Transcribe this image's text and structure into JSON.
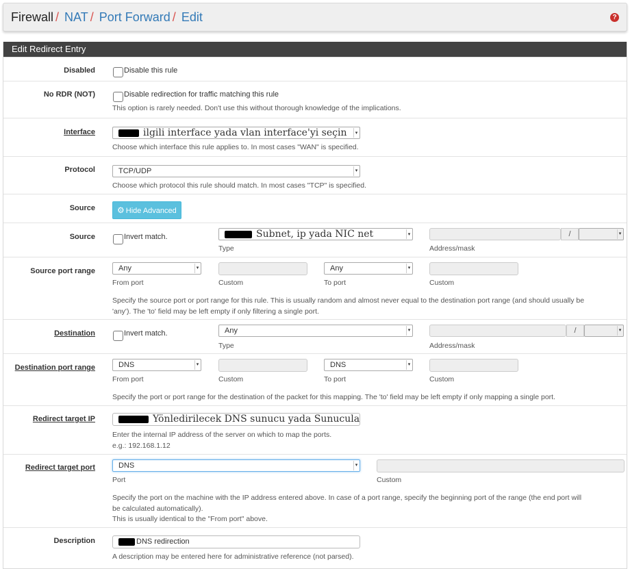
{
  "breadcrumb": {
    "items": [
      "Firewall",
      "NAT",
      "Port Forward",
      "Edit"
    ],
    "separator": "/"
  },
  "panel": {
    "title": "Edit Redirect Entry"
  },
  "disabled": {
    "label": "Disabled",
    "checkbox_text": "Disable this rule",
    "checked": false
  },
  "nordr": {
    "label": "No RDR (NOT)",
    "checkbox_text": "Disable redirection for traffic matching this rule",
    "help": "This option is rarely needed. Don't use this without thorough knowledge of the implications.",
    "checked": false
  },
  "interface": {
    "label": "Interface",
    "value": "ilgili interface yada vlan interface'yi seçin",
    "help": "Choose which interface this rule applies to. In most cases \"WAN\" is specified."
  },
  "protocol": {
    "label": "Protocol",
    "value": "TCP/UDP",
    "help": "Choose which protocol this rule should match. In most cases \"TCP\" is specified."
  },
  "source_adv": {
    "label": "Source",
    "button": "Hide Advanced"
  },
  "source": {
    "label": "Source",
    "invert_text": "Invert match.",
    "type_value": "Subnet, ip yada NIC net",
    "type_caption": "Type",
    "address_caption": "Address/mask",
    "mask_sep": "/"
  },
  "source_port": {
    "label": "Source port range",
    "from_value": "Any",
    "from_caption": "From port",
    "custom1_caption": "Custom",
    "to_value": "Any",
    "to_caption": "To port",
    "custom2_caption": "Custom",
    "help_line1": "Specify the source port or port range for this rule. This is usually random and almost never equal to the destination port range (and should usually be",
    "help_line2": "'any'). The 'to' field may be left empty if only filtering a single port."
  },
  "destination": {
    "label": "Destination",
    "invert_text": "Invert match.",
    "type_value": "Any",
    "type_caption": "Type",
    "address_caption": "Address/mask",
    "mask_sep": "/"
  },
  "dest_port": {
    "label": "Destination port range",
    "from_value": "DNS",
    "from_caption": "From port",
    "custom1_caption": "Custom",
    "to_value": "DNS",
    "to_caption": "To port",
    "custom2_caption": "Custom",
    "help": "Specify the port or port range for the destination of the packet for this mapping. The 'to' field may be left empty if only mapping a single port."
  },
  "redirect_ip": {
    "label": "Redirect target IP",
    "value": "Yönledirilecek DNS sunucu yada Sunucular(alias) ip/ip'ler",
    "help_line1": "Enter the internal IP address of the server on which to map the ports.",
    "help_line2": "e.g.: 192.168.1.12"
  },
  "redirect_port": {
    "label": "Redirect target port",
    "value": "DNS",
    "port_caption": "Port",
    "custom_caption": "Custom",
    "help_line1": "Specify the port on the machine with the IP address entered above. In case of a port range, specify the beginning port of the range (the end port will",
    "help_line2": "be calculated automatically).",
    "help_line3": "This is usually identical to the \"From port\" above."
  },
  "description": {
    "label": "Description",
    "value": "DNS redirection",
    "help": "A description may be entered here for administrative reference (not parsed)."
  },
  "colors": {
    "panel_heading": "#424242",
    "link": "#337ab7",
    "separator": "#d9534f",
    "info_button": "#5bc0de"
  }
}
